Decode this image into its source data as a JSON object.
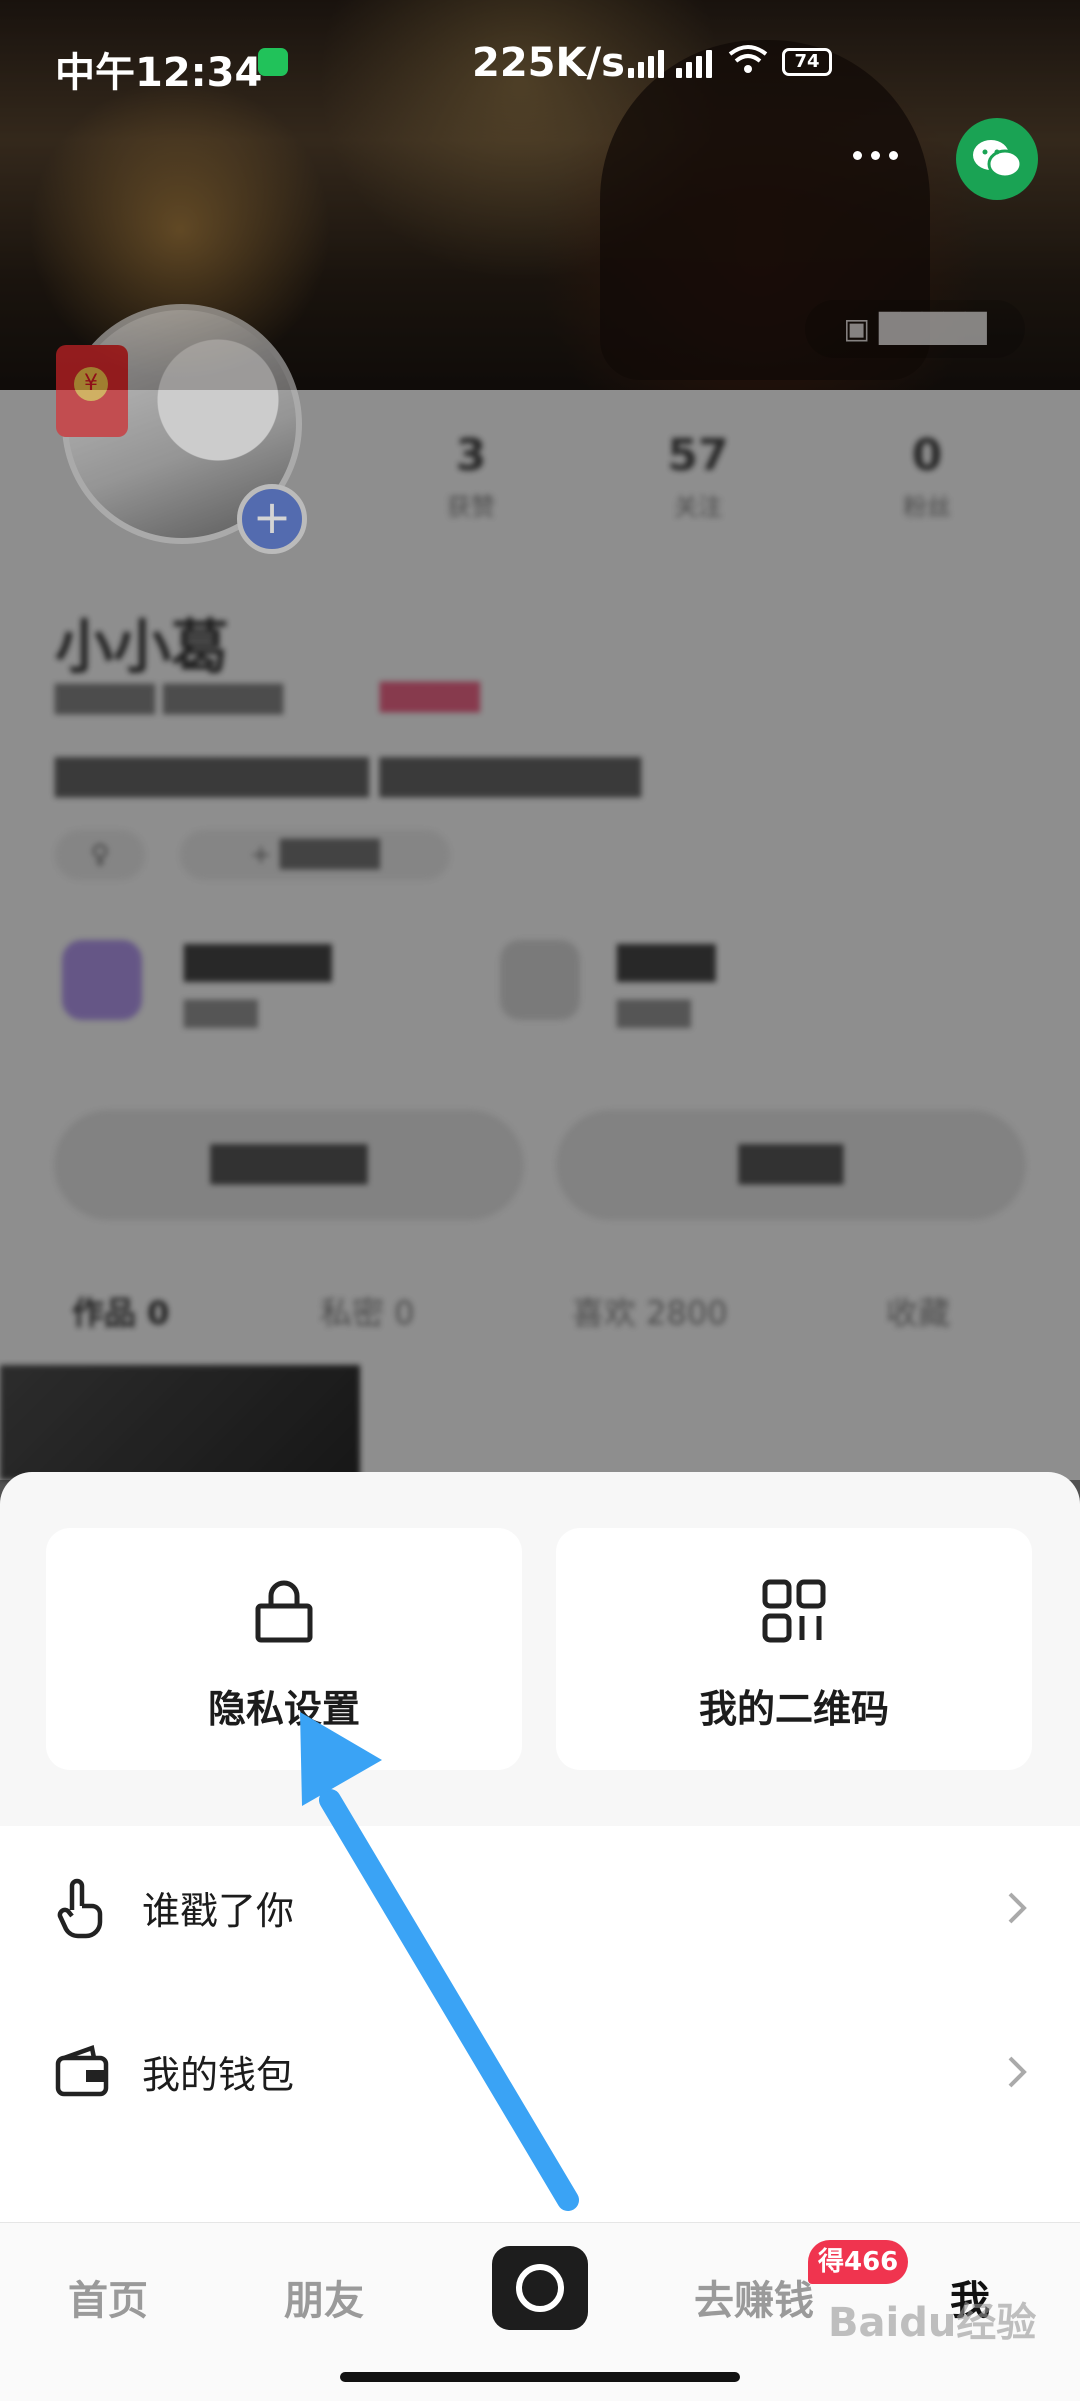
{
  "status_bar": {
    "time": "中午12:34",
    "speed": "225K/s",
    "battery": "74"
  },
  "profile": {
    "stats": [
      {
        "num": "3",
        "label": "获赞"
      },
      {
        "num": "57",
        "label": "关注"
      },
      {
        "num": "0",
        "label": "粉丝"
      }
    ],
    "nickname": "小小葛",
    "tabs": [
      {
        "label": "作品 0"
      },
      {
        "label": "私密 0"
      },
      {
        "label": "喜欢 2800"
      },
      {
        "label": "收藏"
      }
    ]
  },
  "sheet": {
    "cards": [
      {
        "label": "隐私设置",
        "icon": "lock-icon"
      },
      {
        "label": "我的二维码",
        "icon": "qrcode-icon"
      }
    ],
    "rows": [
      {
        "label": "谁戳了你",
        "icon": "hand-tap-icon"
      },
      {
        "label": "我的钱包",
        "icon": "wallet-icon"
      }
    ]
  },
  "tabbar": {
    "home": "首页",
    "friends": "朋友",
    "earn": "去赚钱",
    "earn_badge": "得466",
    "me": "我"
  },
  "colors": {
    "arrow": "#3aa3f5",
    "accent_badge": "#f0344f",
    "wechat": "#1aa354"
  },
  "watermark": "Baidu经验"
}
